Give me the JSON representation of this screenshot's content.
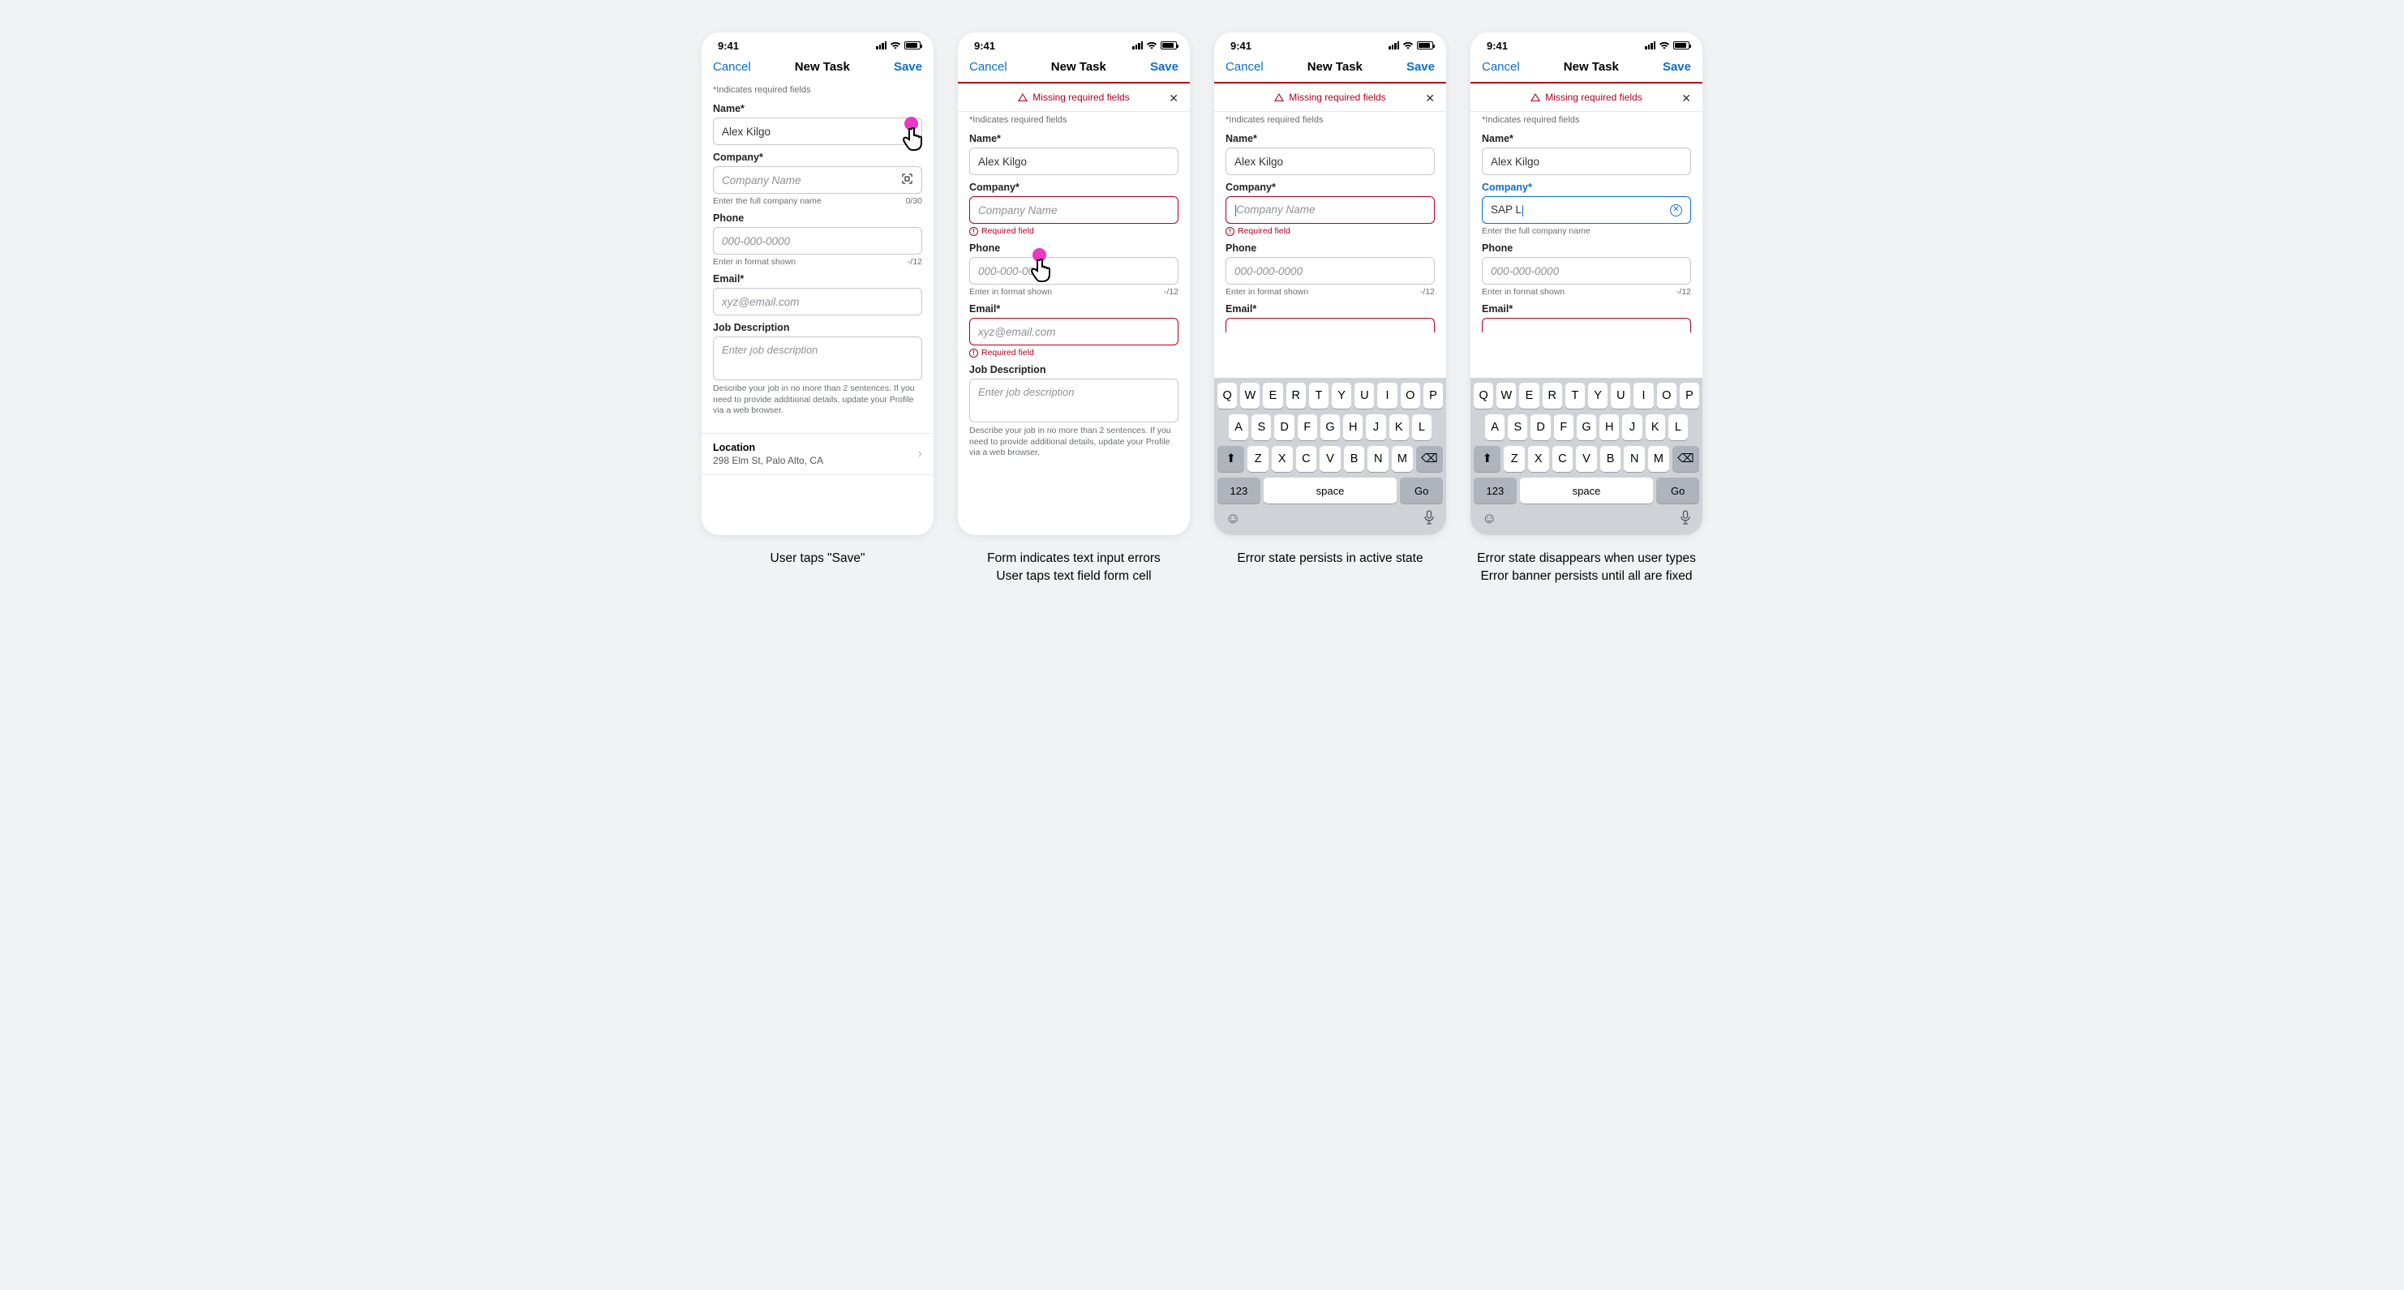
{
  "status": {
    "time": "9:41"
  },
  "nav": {
    "cancel": "Cancel",
    "title": "New Task",
    "save": "Save"
  },
  "banner": {
    "text": "Missing required fields"
  },
  "hint": "*Indicates required fields",
  "fields": {
    "name": {
      "label": "Name*",
      "value": "Alex Kilgo"
    },
    "company": {
      "label": "Company*",
      "placeholder": "Company Name",
      "helper": "Enter the full company name",
      "counter": "0/30",
      "error": "Required field",
      "typed": "SAP L"
    },
    "phone": {
      "label": "Phone",
      "placeholder": "000-000-0000",
      "helper": "Enter in format shown",
      "counter": "-/12"
    },
    "email": {
      "label": "Email*",
      "placeholder": "xyz@email.com",
      "error": "Required field"
    },
    "job": {
      "label": "Job Description",
      "placeholder": "Enter job description",
      "helper": "Describe your job in no more than 2 sentences. If you need to provide additional details, update your Profile via a web browser."
    }
  },
  "location": {
    "label": "Location",
    "value": "298 Elm St, Palo Alto, CA"
  },
  "keyboard": {
    "row1": [
      "Q",
      "W",
      "E",
      "R",
      "T",
      "Y",
      "U",
      "I",
      "O",
      "P"
    ],
    "row2": [
      "A",
      "S",
      "D",
      "F",
      "G",
      "H",
      "J",
      "K",
      "L"
    ],
    "row3": [
      "Z",
      "X",
      "C",
      "V",
      "B",
      "N",
      "M"
    ],
    "n123": "123",
    "space": "space",
    "go": "Go"
  },
  "captions": {
    "c1": "User taps \"Save\"",
    "c2a": "Form indicates text input errors",
    "c2b": "User taps text field form cell",
    "c3": "Error state persists in active state",
    "c4a": "Error state disappears when user types",
    "c4b": "Error banner persists until all are fixed"
  }
}
